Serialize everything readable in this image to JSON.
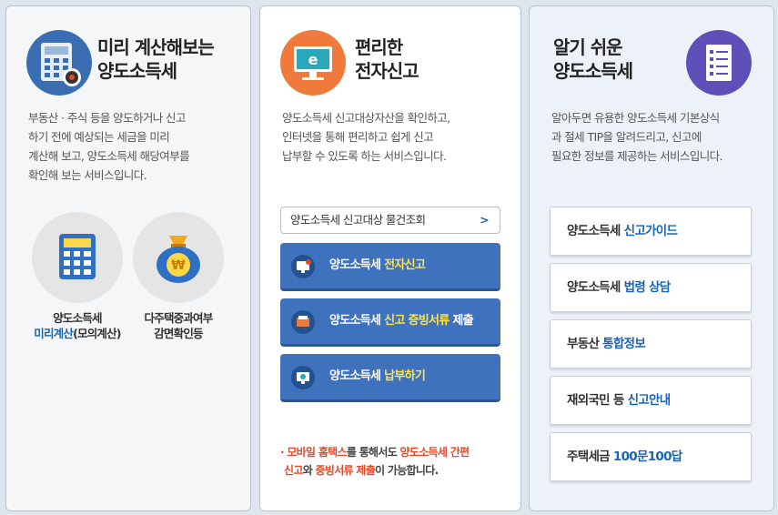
{
  "calculator": {
    "title_line1": "미리 계산해보는",
    "title_line2": "양도소득세",
    "desc_line1": "부동산 · 주식 등을 양도하거나 신고",
    "desc_line2": "하기 전에 예상되는 세금을 미리",
    "desc_line3": "계산해 보고, 양도소득세 해당여부를",
    "desc_line4": "확인해 보는 서비스입니다.",
    "sub_calc": {
      "line1": "양도소득세",
      "line2_hl": "미리계산",
      "line2_rest": "(모의계산)"
    },
    "sub_multi": {
      "line1": "다주택중과여부",
      "line2": "감면확인등"
    }
  },
  "efiling": {
    "title_line1": "편리한",
    "title_line2": "전자신고",
    "desc_line1": "양도소득세 신고대상자산을 확인하고,",
    "desc_line2": "인터넷을 통해 편리하고 쉽게 신고",
    "desc_line3": "납부할 수 있도록 하는 서비스입니다.",
    "lookup_label": "양도소득세 신고대상 물건조회",
    "lookup_chevron": ">",
    "btn1": {
      "prefix": "양도소득세 ",
      "hl": "전자신고",
      "suffix": ""
    },
    "btn2": {
      "prefix": "양도소득세 ",
      "hl": "신고 증빙서류",
      "suffix": " 제출"
    },
    "btn3": {
      "prefix": "양도소득세 ",
      "hl": "납부하기",
      "suffix": ""
    },
    "note": {
      "bullet": "·",
      "part1": "모바일 홈택스",
      "part2": "를 통해서도 ",
      "part3": "양도소득세 간편",
      "part4": "신고",
      "part5": "와 ",
      "part6": "증빙서류 제출",
      "part7": "이 가능합니다."
    }
  },
  "guide": {
    "title_line1": "알기 쉬운",
    "title_line2": "양도소득세",
    "desc_line1": "알아두면 유용한 양도소득세 기본상식",
    "desc_line2": "과 절세 TIP을 알려드리고, 신고에",
    "desc_line3": "필요한 정보를 제공하는 서비스입니다.",
    "links": [
      {
        "prefix": "양도소득세 ",
        "hl": "신고가이드"
      },
      {
        "prefix": "양도소득세 ",
        "hl": "법령 상담"
      },
      {
        "prefix": "부동산 ",
        "hl": "통합정보"
      },
      {
        "prefix": "재외국민 등 ",
        "hl": "신고안내"
      },
      {
        "prefix": "주택세금 ",
        "hl": "100문100답"
      }
    ]
  },
  "colors": {
    "accent_blue": "#1a64b4",
    "button_blue": "#3e72bd",
    "highlight_yellow": "#ffe34d",
    "note_red": "#e8482a",
    "icon_orange": "#ef7a3c",
    "icon_purple": "#5f4fb8"
  }
}
